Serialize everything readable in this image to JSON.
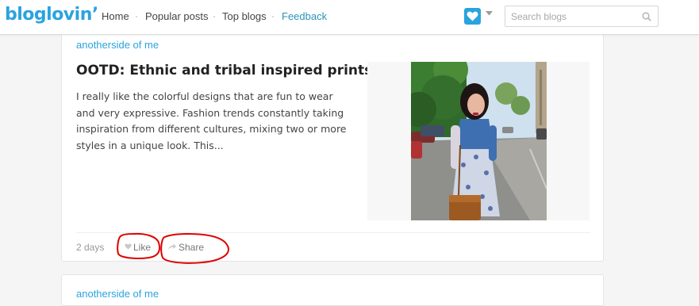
{
  "header": {
    "logo": "bloglovin’",
    "nav": [
      "Home",
      "Popular posts",
      "Top blogs",
      "Feedback"
    ],
    "search_placeholder": "Search blogs",
    "colors": {
      "brand": "#2aa3de",
      "feedback_link": "#2a93b8"
    }
  },
  "post": {
    "blog_name": "anotherside of me",
    "title": "OOTD: Ethnic and tribal inspired prints",
    "excerpt": "I really like the colorful designs that are fun to wear and very expressive. Fashion trends constantly taking inspiration from different cultures, mixing two or more styles in a unique look. This...",
    "time": "2 days",
    "actions": {
      "like": "Like",
      "share": "Share"
    },
    "annotation_color": "#e00000"
  },
  "next_post": {
    "blog_name": "anotherside of me"
  },
  "icons": [
    "heart-icon",
    "chevron-down-icon",
    "search-icon",
    "like-heart-icon",
    "share-arrow-icon"
  ]
}
